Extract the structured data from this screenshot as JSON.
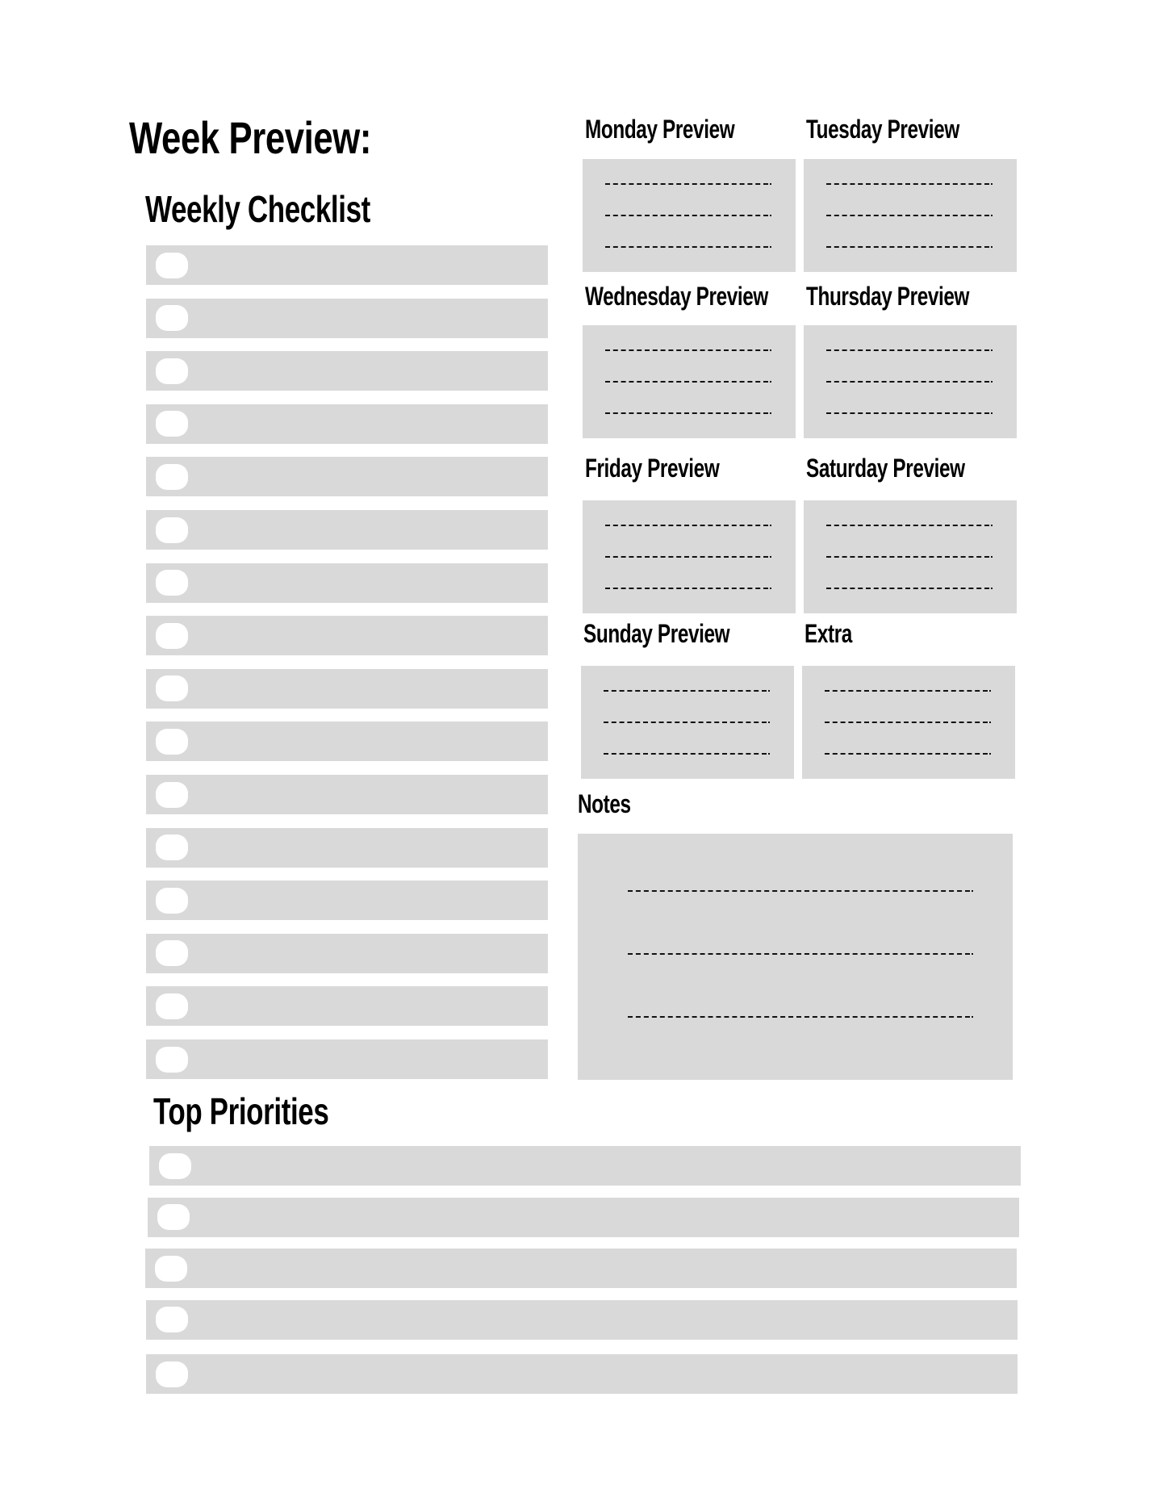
{
  "page_title": "Week Preview:",
  "weekly_checklist": {
    "heading": "Weekly Checklist",
    "item_count": 16
  },
  "day_previews": [
    {
      "label": "Monday Preview",
      "lines": 3
    },
    {
      "label": "Tuesday Preview",
      "lines": 3
    },
    {
      "label": "Wednesday Preview",
      "lines": 3
    },
    {
      "label": "Thursday Preview",
      "lines": 3
    },
    {
      "label": "Friday Preview",
      "lines": 3
    },
    {
      "label": "Saturday Preview",
      "lines": 3
    },
    {
      "label": "Sunday Preview",
      "lines": 3
    },
    {
      "label": "Extra",
      "lines": 3
    }
  ],
  "notes": {
    "heading": "Notes",
    "lines": 3
  },
  "top_priorities": {
    "heading": "Top Priorities",
    "item_count": 5
  },
  "colors": {
    "background": "#ffffff",
    "panel": "#d9d9d9",
    "checkbox": "#ffffff",
    "text": "#000000"
  }
}
